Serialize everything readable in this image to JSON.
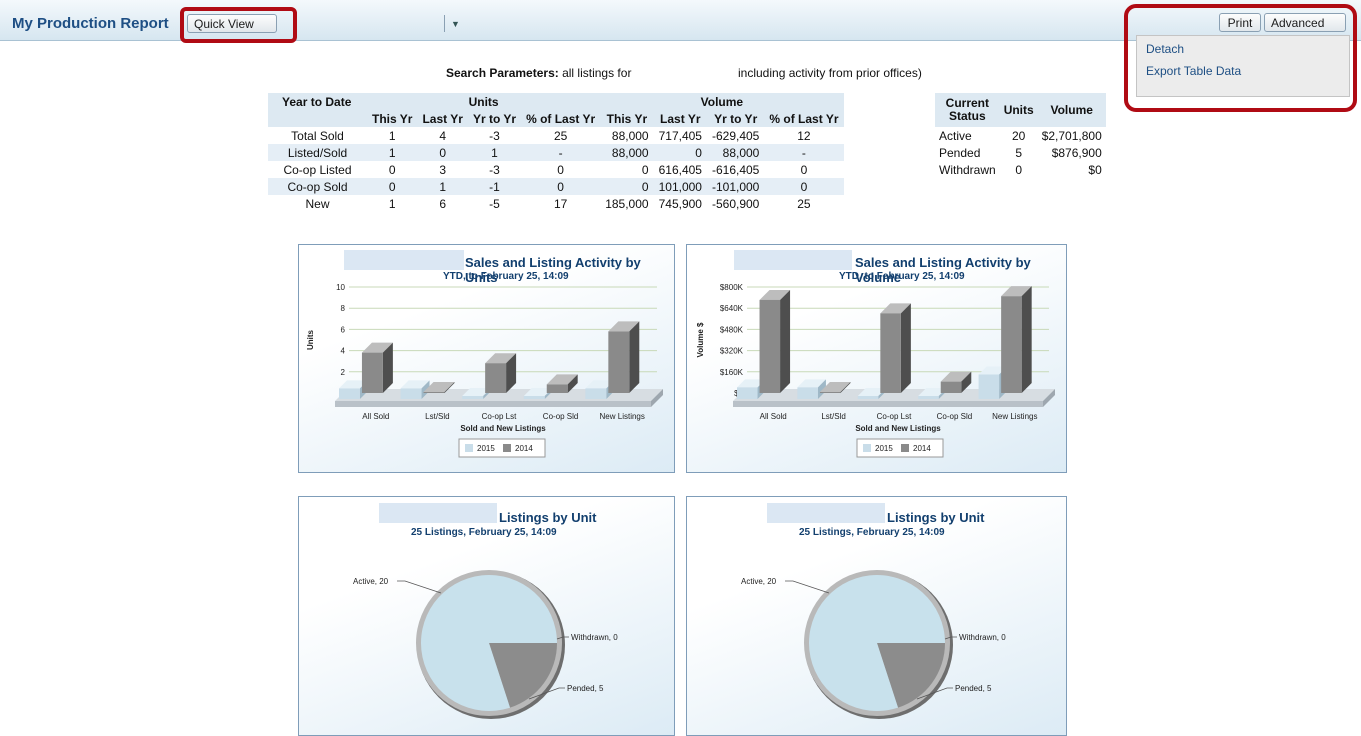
{
  "header": {
    "title": "My Production Report",
    "quick_view_label": "Quick View",
    "print_label": "Print",
    "advanced_label": "Advanced"
  },
  "advanced_menu": {
    "items": [
      "Detach",
      "Export Table Data"
    ]
  },
  "search": {
    "label": "Search Parameters:",
    "text_left": "all listings for",
    "text_right": "including activity from prior offices)"
  },
  "ytd_table": {
    "group_headers": [
      "Year to Date",
      "Units",
      "Volume"
    ],
    "sub_headers": [
      "This Yr",
      "Last Yr",
      "Yr to Yr",
      "% of Last Yr",
      "This Yr",
      "Last Yr",
      "Yr to Yr",
      "% of Last Yr"
    ],
    "rows": [
      {
        "label": "Total Sold",
        "cells": [
          "1",
          "4",
          "-3",
          "25",
          "88,000",
          "717,405",
          "-629,405",
          "12"
        ]
      },
      {
        "label": "Listed/Sold",
        "cells": [
          "1",
          "0",
          "1",
          "-",
          "88,000",
          "0",
          "88,000",
          "-"
        ]
      },
      {
        "label": "Co-op Listed",
        "cells": [
          "0",
          "3",
          "-3",
          "0",
          "0",
          "616,405",
          "-616,405",
          "0"
        ]
      },
      {
        "label": "Co-op Sold",
        "cells": [
          "0",
          "1",
          "-1",
          "0",
          "0",
          "101,000",
          "-101,000",
          "0"
        ]
      },
      {
        "label": "New",
        "cells": [
          "1",
          "6",
          "-5",
          "17",
          "185,000",
          "745,900",
          "-560,900",
          "25"
        ]
      }
    ]
  },
  "status_table": {
    "headers": [
      "Current Status",
      "Units",
      "Volume"
    ],
    "rows": [
      {
        "label": "Active",
        "units": "20",
        "volume": "$2,701,800"
      },
      {
        "label": "Pended",
        "units": "5",
        "volume": "$876,900"
      },
      {
        "label": "Withdrawn",
        "units": "0",
        "volume": "$0"
      }
    ]
  },
  "colors": {
    "series_2015": "#c9dde9",
    "series_2014": "#8a8a8a",
    "pie_active": "#c8e1ec",
    "pie_pended": "#8c8c8c",
    "highlight": "#b00b14",
    "title_blue": "#1e4f84"
  },
  "chart_data": [
    {
      "type": "bar",
      "title": "Sales and Listing Activity by Units",
      "subtitle": "YTD, to February 25, 14:09",
      "xlabel": "Sold and New Listings",
      "ylabel": "Units",
      "categories": [
        "All Sold",
        "Lst/Sld",
        "Co-op Lst",
        "Co-op Sld",
        "New Listings"
      ],
      "series": [
        {
          "name": "2015",
          "values": [
            1,
            1,
            0,
            0,
            1
          ]
        },
        {
          "name": "2014",
          "values": [
            4,
            0,
            3,
            1,
            6
          ]
        }
      ],
      "ylim": [
        0,
        10
      ],
      "yticks": [
        "0",
        "2",
        "4",
        "6",
        "8",
        "10"
      ],
      "grid": true,
      "legend": "bottom-center"
    },
    {
      "type": "bar",
      "title": "Sales and Listing Activity by Volume",
      "subtitle": "YTD, to February 25, 14:09",
      "xlabel": "Sold and New Listings",
      "ylabel": "Volume $",
      "categories": [
        "All Sold",
        "Lst/Sld",
        "Co-op Lst",
        "Co-op Sld",
        "New Listings"
      ],
      "series": [
        {
          "name": "2015",
          "values": [
            88000,
            88000,
            0,
            0,
            185000
          ]
        },
        {
          "name": "2014",
          "values": [
            717405,
            0,
            616405,
            101000,
            745900
          ]
        }
      ],
      "ylim": [
        0,
        800000
      ],
      "yticks": [
        "$0",
        "$160K",
        "$320K",
        "$480K",
        "$640K",
        "$800K"
      ],
      "grid": true,
      "legend": "bottom-center"
    },
    {
      "type": "pie",
      "title": "Listings by Unit",
      "subtitle": "25 Listings, February 25, 14:09",
      "slices": [
        {
          "label": "Active, 20",
          "value": 20
        },
        {
          "label": "Pended, 5",
          "value": 5
        },
        {
          "label": "Withdrawn, 0",
          "value": 0
        }
      ]
    },
    {
      "type": "pie",
      "title": "Listings by Unit",
      "subtitle": "25 Listings, February 25, 14:09",
      "slices": [
        {
          "label": "Active, 20",
          "value": 20
        },
        {
          "label": "Pended, 5",
          "value": 5
        },
        {
          "label": "Withdrawn, 0",
          "value": 0
        }
      ]
    }
  ]
}
